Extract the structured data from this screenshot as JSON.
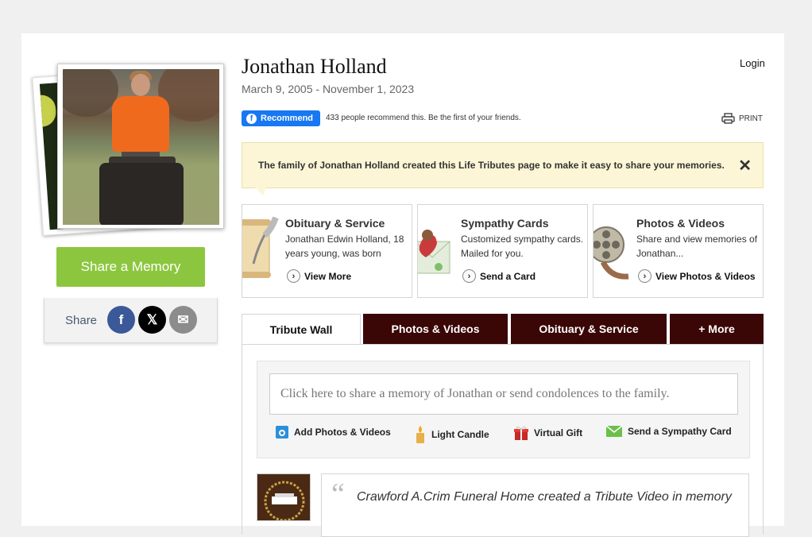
{
  "header": {
    "name": "Jonathan Holland",
    "dates": "March 9, 2005 - November 1, 2023",
    "login": "Login",
    "recommend_label": "Recommend",
    "recommend_text": "433 people recommend this. Be the first of your friends.",
    "print_label": "PRINT"
  },
  "sidebar": {
    "share_memory": "Share a Memory",
    "share_label": "Share",
    "share_buttons": [
      {
        "name": "facebook",
        "glyph": "f",
        "color": "#3b5998"
      },
      {
        "name": "x",
        "glyph": "𝕏",
        "color": "#000000"
      },
      {
        "name": "email",
        "glyph": "✉",
        "color": "#8c8c8c"
      }
    ]
  },
  "notice": {
    "text": "The family of Jonathan Holland created this Life Tributes page to make it easy to share your memories.",
    "close": "✕"
  },
  "cards": [
    {
      "title": "Obituary & Service",
      "desc": "Jonathan Edwin Holland, 18 years young, was born",
      "link": "View More",
      "icon": "scroll-quill-icon"
    },
    {
      "title": "Sympathy Cards",
      "desc": "Customized sympathy cards. Mailed for you.",
      "link": "Send a Card",
      "icon": "envelope-heart-icon"
    },
    {
      "title": "Photos & Videos",
      "desc": "Share and view memories of Jonathan...",
      "link": "View Photos & Videos",
      "icon": "film-reel-icon"
    }
  ],
  "tabs": [
    {
      "label": "Tribute Wall",
      "active": true
    },
    {
      "label": "Photos & Videos",
      "active": false
    },
    {
      "label": "Obituary & Service",
      "active": false
    },
    {
      "label": "+ More",
      "active": false
    }
  ],
  "compose": {
    "placeholder": "Click here to share a memory of Jonathan or send condolences to the family.",
    "actions": [
      {
        "label": "Add Photos & Videos",
        "icon": "camera-icon"
      },
      {
        "label": "Light Candle",
        "icon": "candle-icon"
      },
      {
        "label": "Virtual Gift",
        "icon": "gift-icon"
      },
      {
        "label": "Send a Sympathy Card",
        "icon": "envelope-icon"
      }
    ]
  },
  "post": {
    "quote": "“",
    "text": "Crawford A.Crim Funeral Home created a Tribute Video in memory"
  },
  "colors": {
    "accent_green": "#8cc63e",
    "tab_dark": "#3a0606",
    "facebook_blue": "#1877f2",
    "notice_bg": "#fcf6d6"
  }
}
